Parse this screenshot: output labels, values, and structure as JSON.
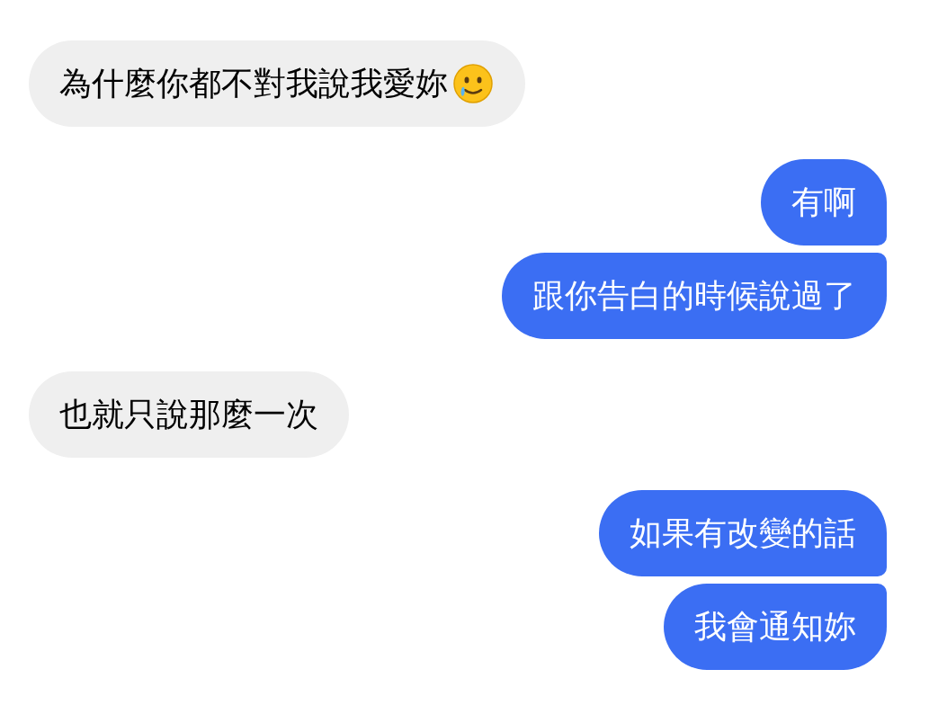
{
  "messages": [
    {
      "kind": "received",
      "text": "為什麼你都不對我說我愛妳",
      "has_emoji": true
    },
    {
      "kind": "sent",
      "text": "有啊",
      "has_emoji": false
    },
    {
      "kind": "sent",
      "text": "跟你告白的時候說過了",
      "has_emoji": false
    },
    {
      "kind": "received",
      "text": "也就只說那麼一次",
      "has_emoji": false
    },
    {
      "kind": "sent",
      "text": "如果有改變的話",
      "has_emoji": false
    },
    {
      "kind": "sent",
      "text": "我會通知妳",
      "has_emoji": false
    }
  ]
}
